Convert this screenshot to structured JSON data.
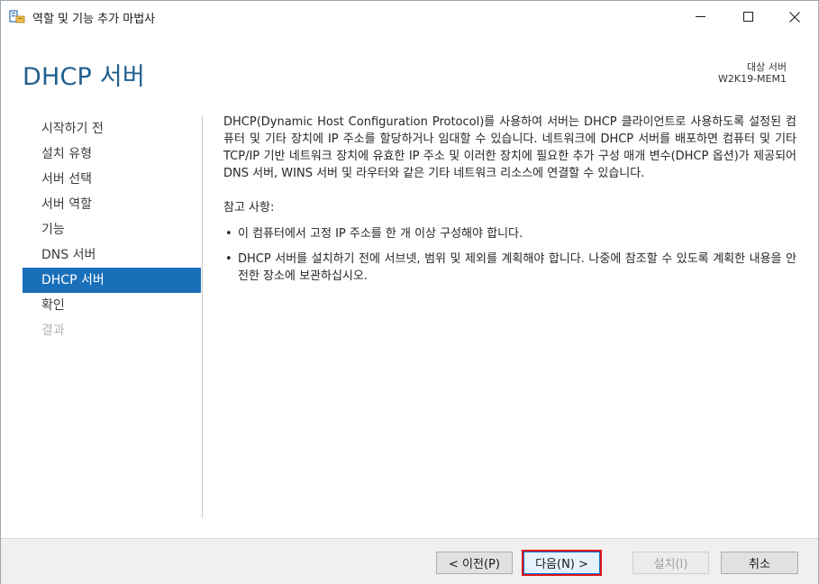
{
  "window": {
    "title": "역할 및 기능 추가 마법사"
  },
  "header": {
    "page_title": "DHCP 서버",
    "target_label": "대상 서버",
    "target_value": "W2K19-MEM1"
  },
  "nav": {
    "items": [
      {
        "label": "시작하기 전",
        "state": "normal"
      },
      {
        "label": "설치 유형",
        "state": "normal"
      },
      {
        "label": "서버 선택",
        "state": "normal"
      },
      {
        "label": "서버 역할",
        "state": "normal"
      },
      {
        "label": "기능",
        "state": "normal"
      },
      {
        "label": "DNS 서버",
        "state": "normal"
      },
      {
        "label": "DHCP 서버",
        "state": "active"
      },
      {
        "label": "확인",
        "state": "normal"
      },
      {
        "label": "결과",
        "state": "disabled"
      }
    ]
  },
  "content": {
    "intro": "DHCP(Dynamic Host Configuration Protocol)를 사용하여 서버는 DHCP 클라이언트로 사용하도록 설정된 컴퓨터 및 기타 장치에 IP 주소를 할당하거나 임대할 수 있습니다. 네트워크에 DHCP 서버를 배포하면 컴퓨터 및 기타 TCP/IP 기반 네트워크 장치에 유효한 IP 주소 및 이러한 장치에 필요한 추가 구성 매개 변수(DHCP 옵션)가 제공되어 DNS 서버, WINS 서버 및 라우터와 같은 기타 네트워크 리소스에 연결할 수 있습니다.",
    "notes_title": "참고 사항:",
    "notes": [
      "이 컴퓨터에서 고정 IP 주소를 한 개 이상 구성해야 합니다.",
      "DHCP 서버를 설치하기 전에 서브넷, 범위 및 제외를 계획해야 합니다. 나중에 참조할 수 있도록 계획한 내용을 안전한 장소에 보관하십시오."
    ]
  },
  "footer": {
    "prev_label": "< 이전(P)",
    "next_label": "다음(N) >",
    "install_label": "설치(I)",
    "cancel_label": "취소"
  },
  "colors": {
    "accent": "#1a6fb9",
    "title": "#1f5f8e",
    "highlight_border": "#e0141b"
  }
}
